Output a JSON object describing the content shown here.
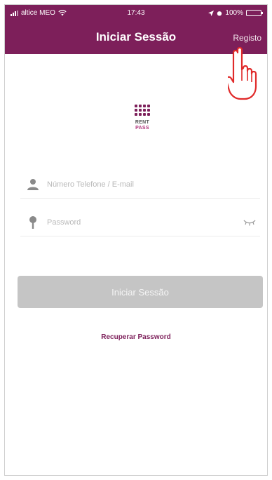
{
  "status_bar": {
    "carrier": "altice MEO",
    "time": "17:43",
    "battery": "100%"
  },
  "header": {
    "title": "Iniciar Sessão",
    "right_action": "Registo"
  },
  "logo": {
    "line1": "RENT",
    "line2": "PASS"
  },
  "form": {
    "identifier_placeholder": "Número Telefone / E-mail",
    "password_placeholder": "Password",
    "submit_label": "Iniciar Sessão",
    "recover_label": "Recuperar Password"
  },
  "colors": {
    "brand": "#7d1f5a",
    "button_disabled": "#c5c5c5"
  },
  "icons": {
    "identifier": "person-icon",
    "password": "pin-icon",
    "toggle": "eye-closed-icon",
    "pointer": "hand-pointer-icon"
  }
}
